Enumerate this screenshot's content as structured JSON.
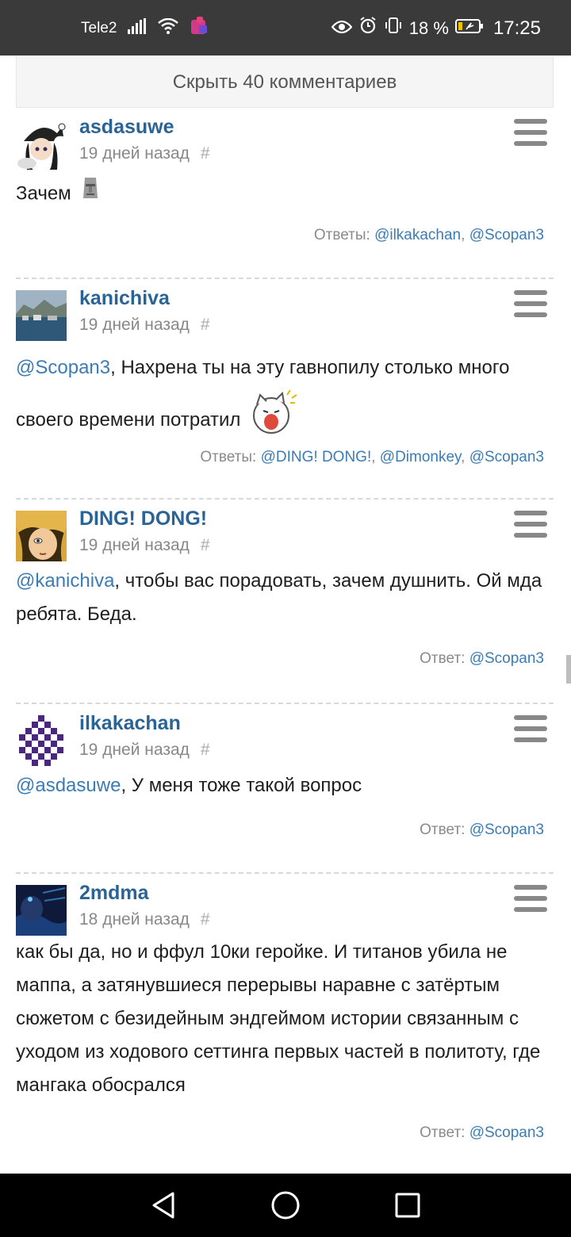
{
  "status_bar": {
    "carrier": "Tele2",
    "battery": "18 %",
    "time": "17:25"
  },
  "hide_comments_label": "Скрыть 40 комментариев",
  "comments": [
    {
      "username": "asdasuwe",
      "time": "19 дней назад",
      "hash": "#",
      "text": "Зачем",
      "replies_label": "Ответы:",
      "replies": [
        "@ilkakachan",
        "@Scopan3"
      ]
    },
    {
      "username": "kanichiva",
      "time": "19 дней назад",
      "hash": "#",
      "mention": "@Scopan3",
      "text": ", Нахрена ты на эту гавнопилу столько много своего времени потратил",
      "replies_label": "Ответы:",
      "replies": [
        "@DING! DONG!",
        "@Dimonkey",
        "@Scopan3"
      ]
    },
    {
      "username": "DING! DONG!",
      "time": "19 дней назад",
      "hash": "#",
      "mention": "@kanichiva",
      "text": ", чтобы вас порадовать, зачем душнить. Ой мда ребята. Беда.",
      "replies_label": "Ответ:",
      "replies": [
        "@Scopan3"
      ]
    },
    {
      "username": "ilkakachan",
      "time": "19 дней назад",
      "hash": "#",
      "mention": "@asdasuwe",
      "text": ", У меня тоже такой вопрос",
      "replies_label": "Ответ:",
      "replies": [
        "@Scopan3"
      ]
    },
    {
      "username": "2mdma",
      "time": "18 дней назад",
      "hash": "#",
      "text": "как бы да, но и ффул 10ки геройке. И титанов убила не маппа, а затянувшиеся перерывы наравне с затёртым сюжетом с безидейным эндгеймом истории связанным с уходом из ходового сеттинга первых частей в политоту, где мангака обосрался",
      "replies_label": "Ответ:",
      "replies": [
        "@Scopan3"
      ]
    }
  ],
  "colors": {
    "status_bar_bg": "#3a3a3a",
    "username": "#2a6496",
    "mention": "#3b7cb6",
    "meta": "#888888",
    "nav_bar_bg": "#000000"
  },
  "icons": {
    "status": [
      "signal-icon",
      "wifi-icon",
      "app-icon",
      "eye-icon",
      "alarm-icon",
      "vibrate-icon",
      "battery-icon"
    ],
    "comment_menu": "hamburger-menu-icon",
    "nav": [
      "back-icon",
      "home-icon",
      "recents-icon"
    ]
  }
}
